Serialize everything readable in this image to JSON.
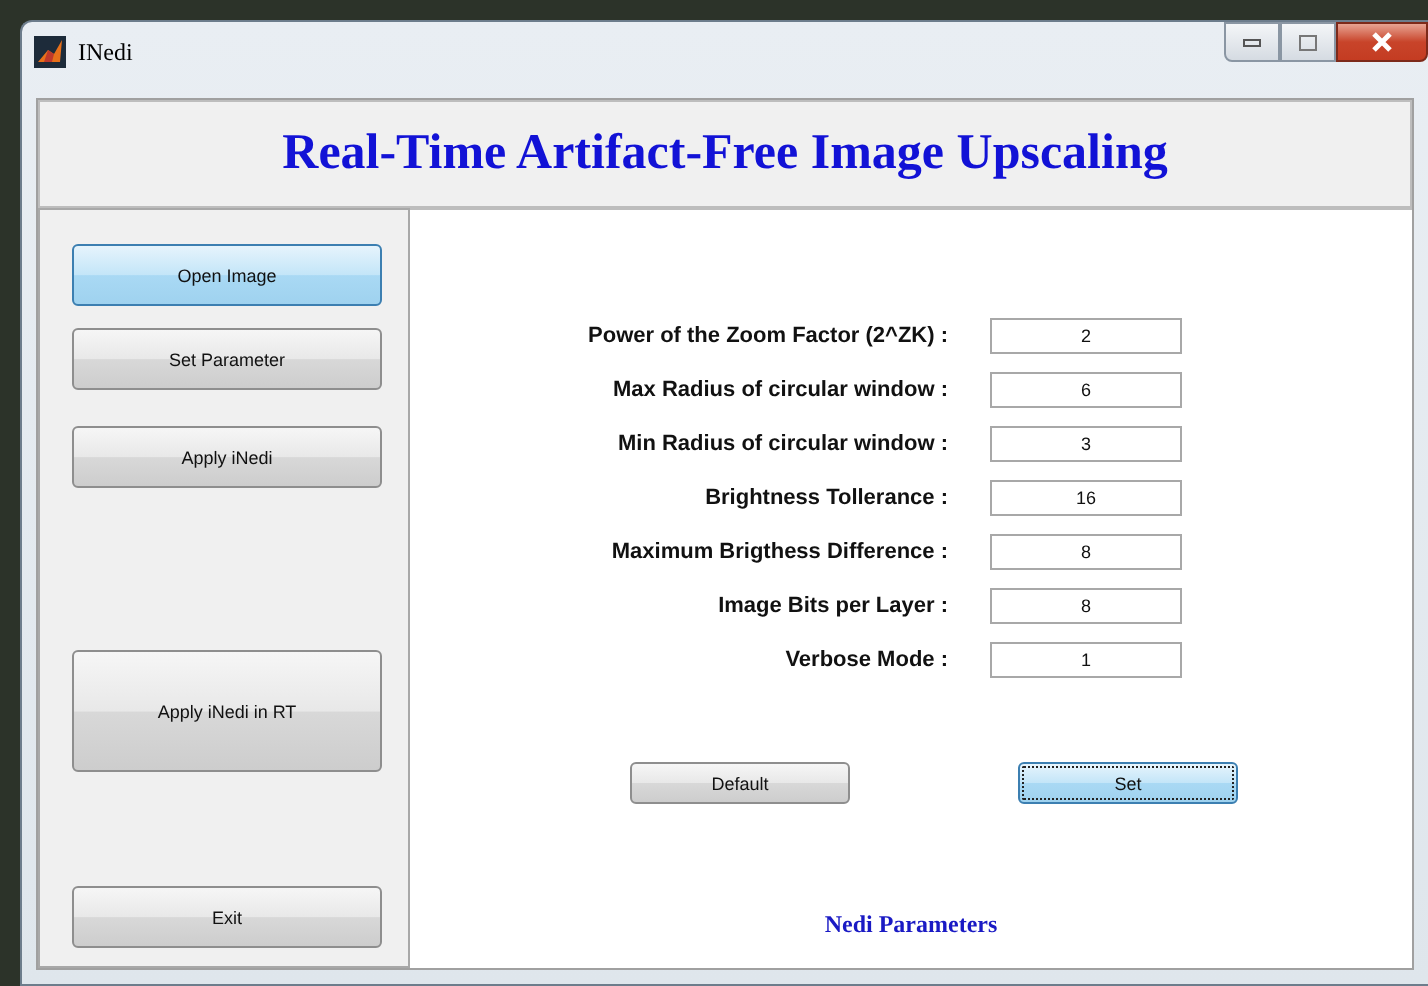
{
  "window": {
    "title": "INedi"
  },
  "header": {
    "title": "Real-Time Artifact-Free Image Upscaling"
  },
  "sidebar": {
    "buttons": [
      {
        "label": "Open Image",
        "kind": "small",
        "highlighted": true
      },
      {
        "label": "Set Parameter",
        "kind": "small",
        "highlighted": false
      },
      {
        "label": "Apply iNedi",
        "kind": "small",
        "highlighted": false
      },
      {
        "label": "Apply iNedi in RT",
        "kind": "large",
        "highlighted": false
      },
      {
        "label": "Exit",
        "kind": "small",
        "highlighted": false
      }
    ]
  },
  "parameters": [
    {
      "label": "Power of the Zoom Factor (2^ZK) :",
      "value": "2"
    },
    {
      "label": "Max Radius of circular window :",
      "value": "6"
    },
    {
      "label": "Min Radius of circular window :",
      "value": "3"
    },
    {
      "label": "Brightness Tollerance :",
      "value": "16"
    },
    {
      "label": "Maximum Brigthess Difference :",
      "value": "8"
    },
    {
      "label": "Image Bits per Layer :",
      "value": "8"
    },
    {
      "label": "Verbose Mode :",
      "value": "1"
    }
  ],
  "actions": [
    {
      "label": "Default",
      "focused": false
    },
    {
      "label": "Set",
      "focused": true
    }
  ],
  "panel_title": "Nedi Parameters"
}
